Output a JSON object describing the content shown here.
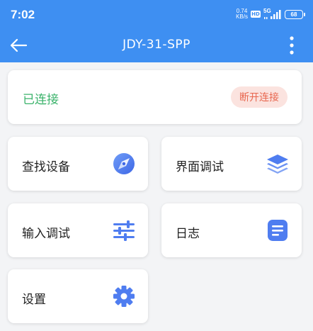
{
  "status_bar": {
    "time": "7:02",
    "net_speed_value": "0.74",
    "net_speed_unit": "KB/s",
    "hd_badge": "HD",
    "network": "5G",
    "battery": "68"
  },
  "navbar": {
    "title": "JDY-31-SPP"
  },
  "connection": {
    "status": "已连接",
    "disconnect_label": "断开连接"
  },
  "menu": [
    {
      "label": "查找设备",
      "icon": "compass-search-icon"
    },
    {
      "label": "界面调试",
      "icon": "layers-icon"
    },
    {
      "label": "输入调试",
      "icon": "sliders-icon"
    },
    {
      "label": "日志",
      "icon": "document-list-icon"
    },
    {
      "label": "设置",
      "icon": "gear-icon"
    }
  ],
  "colors": {
    "primary": "#3e8ff2",
    "connected_green": "#3bb36b",
    "disconnect_text": "#e8674f",
    "disconnect_bg": "#fbe3df",
    "icon_blue": "#4f7df0"
  }
}
